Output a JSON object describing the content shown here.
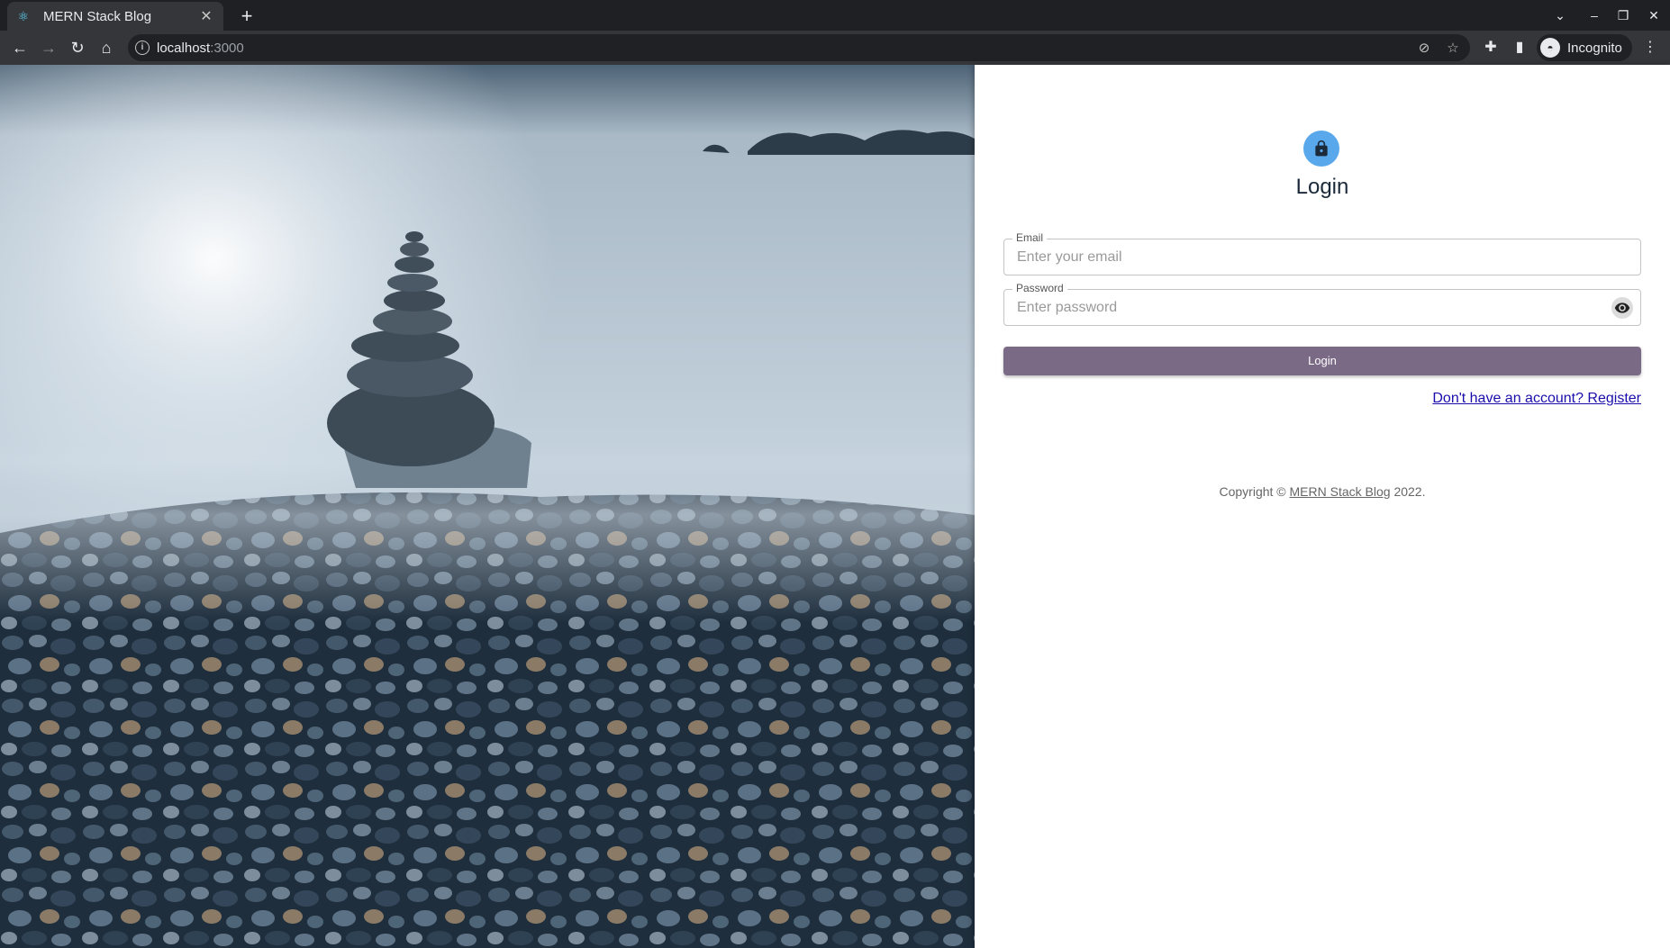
{
  "browser": {
    "tab_title": "MERN Stack Blog",
    "url_host": "localhost",
    "url_port": ":3000",
    "profile_label": "Incognito"
  },
  "login": {
    "heading": "Login",
    "email_label": "Email",
    "email_placeholder": "Enter your email",
    "password_label": "Password",
    "password_placeholder": "Enter password",
    "submit_label": "Login",
    "register_link": "Don't have an account? Register"
  },
  "footer": {
    "prefix": "Copyright © ",
    "site_link": "MERN Stack Blog",
    "suffix": " 2022."
  },
  "colors": {
    "accent_avatar": "#5aa8ec",
    "button": "#7b6a85",
    "link": "#1a0dab"
  }
}
